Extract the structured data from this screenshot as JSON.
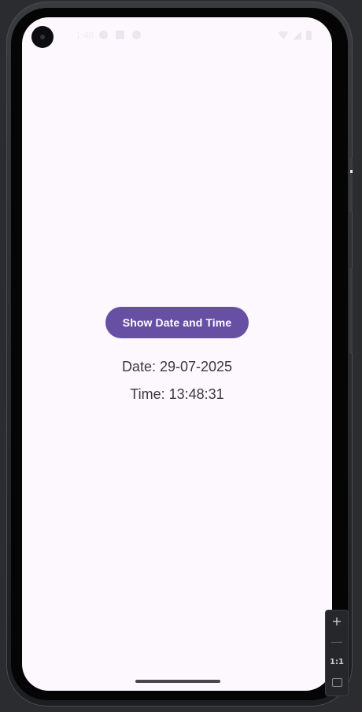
{
  "app": {
    "button_label": "Show Date and Time",
    "date_text": "Date: 29-07-2025",
    "time_text": "Time: 13:48:31"
  },
  "status_bar": {
    "time": "1:48"
  },
  "emulator_controls": {
    "zoom_in_label": "+",
    "zoom_out_label": "—",
    "actual_size_label": "1:1"
  },
  "colors": {
    "screen_background": "#fdf7fe",
    "button_background": "#6750a4",
    "button_text": "#ffffff",
    "body_text": "#3a3840"
  }
}
